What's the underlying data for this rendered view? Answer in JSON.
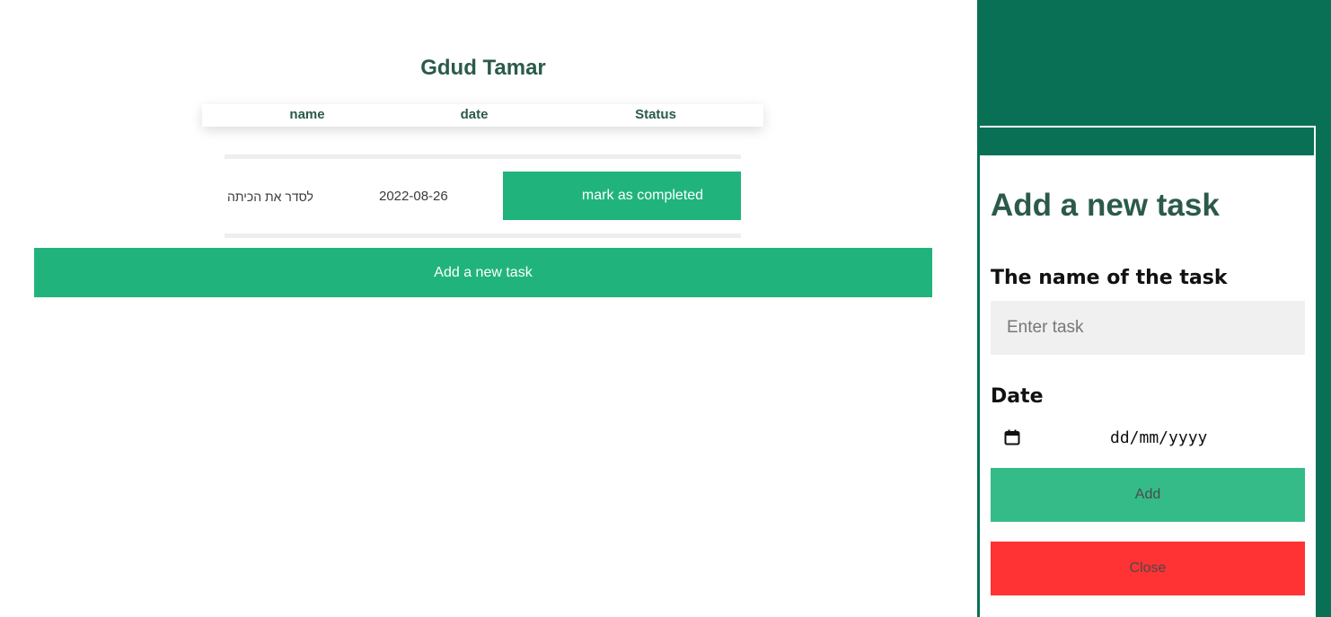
{
  "page": {
    "title": "Gdud Tamar"
  },
  "table": {
    "headers": {
      "name": "name",
      "date": "date",
      "status": "Status"
    },
    "rows": [
      {
        "name": "לסדר את הכיתה",
        "date": "2022-08-26",
        "action_label": "mark as completed"
      }
    ]
  },
  "main": {
    "add_task_label": "Add a new task"
  },
  "modal": {
    "title": "Add a new task",
    "task_label": "The name of the task",
    "task_placeholder": "Enter task",
    "task_value": "",
    "date_label": "Date",
    "date_placeholder": "dd/mm/yyyy",
    "add_label": "Add",
    "close_label": "Close"
  },
  "colors": {
    "accent_green": "#20b47c",
    "panel_green": "#0a7055",
    "heading_green": "#2b5a4c",
    "close_red": "#ff3333"
  },
  "icons": {
    "date": "calendar-icon"
  }
}
